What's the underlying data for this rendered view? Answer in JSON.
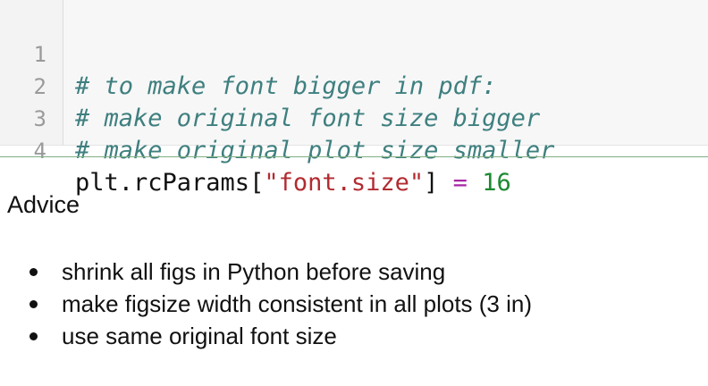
{
  "code_cell": {
    "lines": [
      {
        "number": "1",
        "comment": "# to make font bigger in pdf:"
      },
      {
        "number": "2",
        "comment": "# make original font size bigger"
      },
      {
        "number": "3",
        "comment": "# make original plot size smaller"
      },
      {
        "number": "4",
        "prefix": "plt.rcParams[",
        "string": "\"font.size\"",
        "suffix": "] ",
        "operator": "=",
        "value": "16"
      }
    ]
  },
  "markdown_cell": {
    "title": "Advice",
    "items": [
      "shrink all figs in Python before saving",
      "make figsize width consistent in all plots (3 in)",
      "use same original font size"
    ]
  },
  "colors": {
    "comment": "#3f7f7f",
    "string": "#b22b31",
    "operator": "#a626a4",
    "number": "#1a8a30",
    "separator": "#7fae84"
  }
}
